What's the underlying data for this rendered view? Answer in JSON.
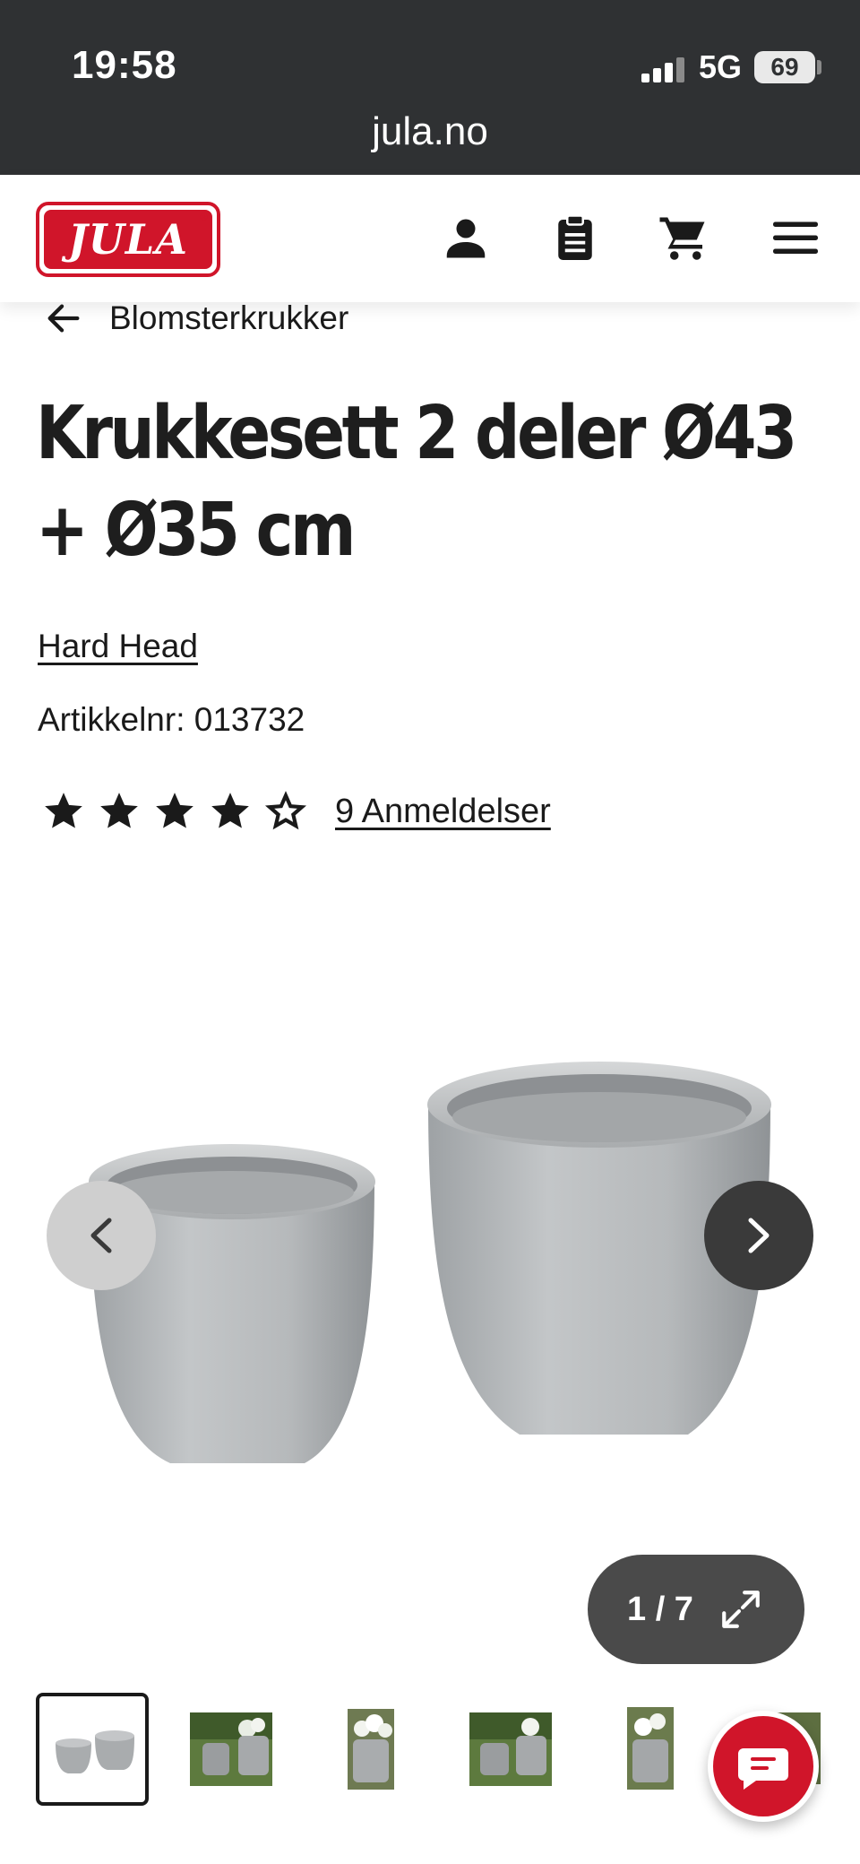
{
  "status_bar": {
    "time": "19:58",
    "network": "5G",
    "battery": "69"
  },
  "browser": {
    "url": "jula.no"
  },
  "header": {
    "logo_text": "JULA",
    "icons": [
      "account-icon",
      "clipboard-icon",
      "cart-icon",
      "menu-icon"
    ]
  },
  "breadcrumb": {
    "label": "Blomsterkrukker"
  },
  "product": {
    "title": "Krukkesett 2 deler Ø43 + Ø35 cm",
    "brand": "Hard Head",
    "article_number": "Artikkelnr: 013732",
    "rating": 4,
    "rating_max": 5,
    "reviews_label": "9 Anmeldelser"
  },
  "gallery": {
    "counter": "1 / 7",
    "current": 1,
    "total": 7
  },
  "thumbnails": [
    {
      "name": "two-grey-pots",
      "active": true
    },
    {
      "name": "pots-garden-1",
      "active": false
    },
    {
      "name": "pot-white-flowers-1",
      "active": false
    },
    {
      "name": "pots-garden-2",
      "active": false
    },
    {
      "name": "pot-white-flowers-2",
      "active": false
    },
    {
      "name": "pot-partial",
      "active": false
    }
  ],
  "colors": {
    "brand_red": "#d0152a",
    "status_bar": "#2f3133",
    "text": "#1a1a1a"
  }
}
